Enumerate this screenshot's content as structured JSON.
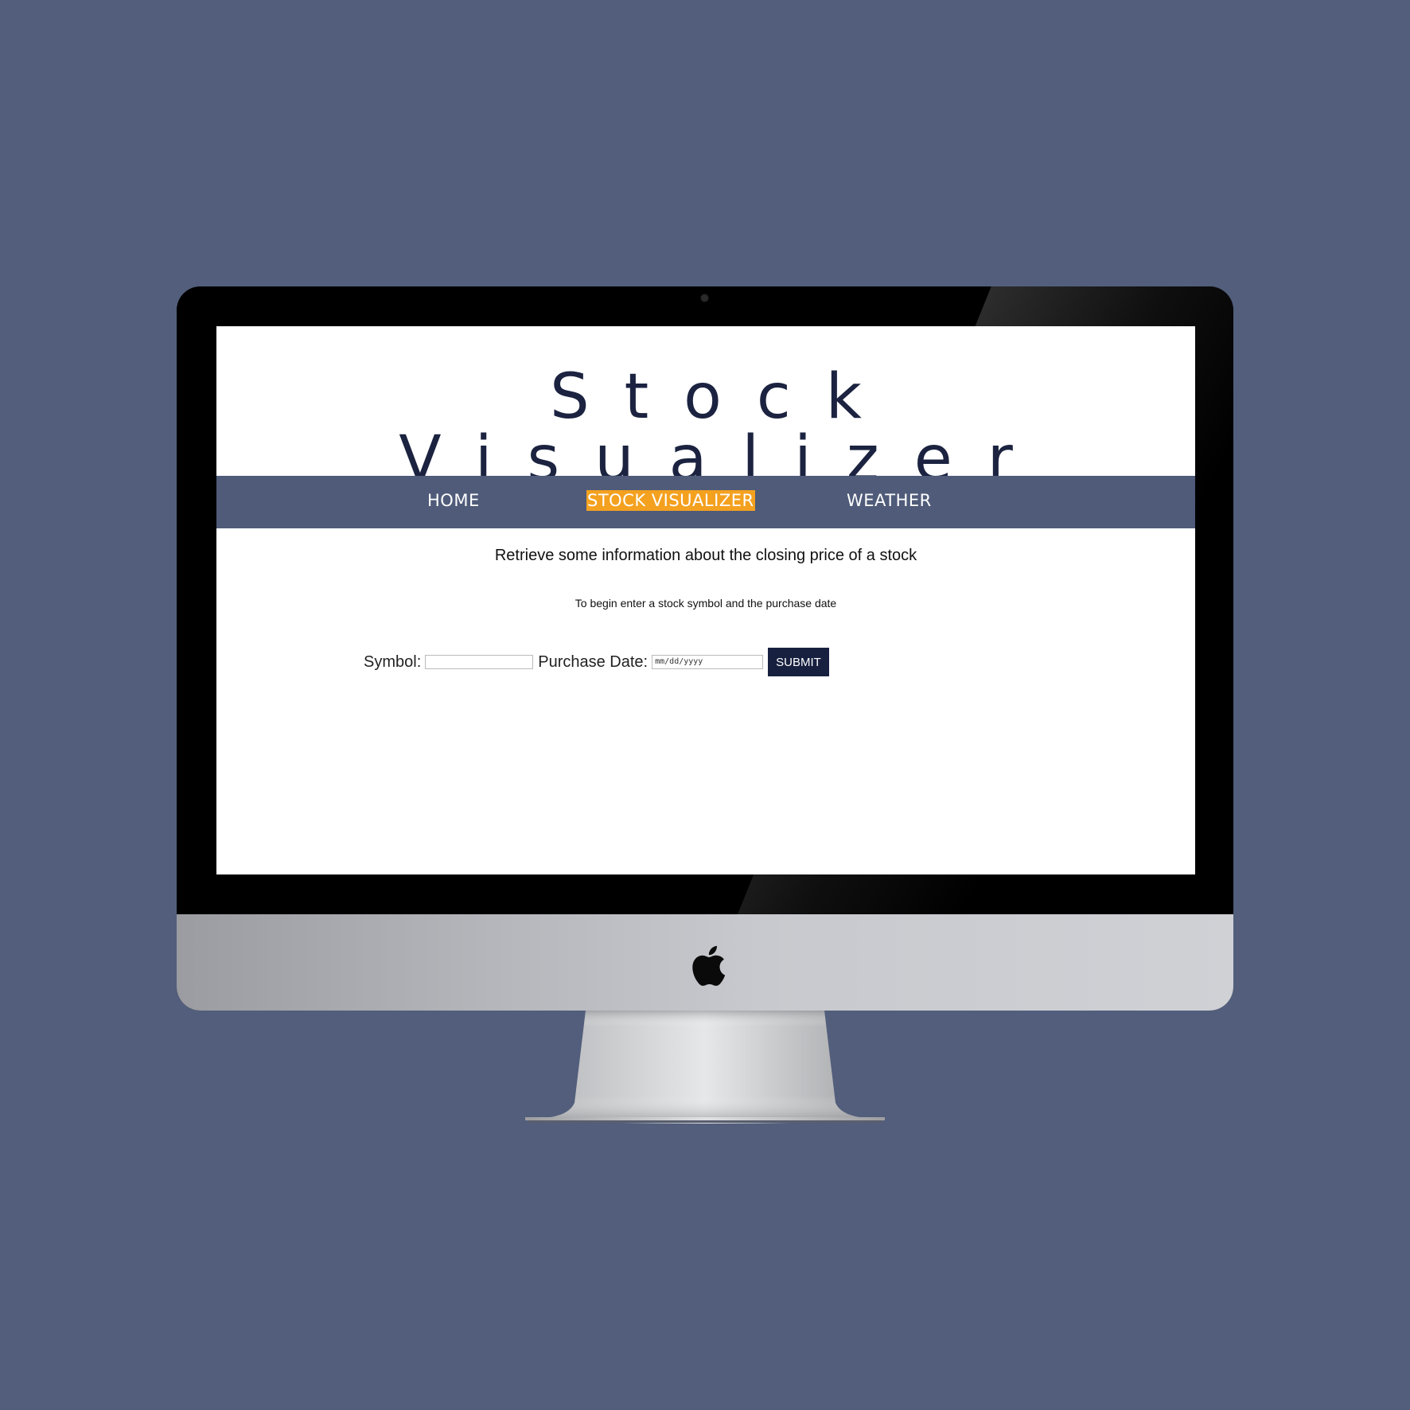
{
  "site": {
    "title": "Stock Visualizer"
  },
  "nav": {
    "items": [
      {
        "label": "HOME",
        "active": false
      },
      {
        "label": "STOCK VISUALIZER",
        "active": true
      },
      {
        "label": "WEATHER",
        "active": false
      }
    ]
  },
  "main": {
    "headline": "Retrieve some information about the closing price of a stock",
    "subline": "To begin enter a stock symbol and the purchase date"
  },
  "form": {
    "symbol_label": "Symbol:",
    "symbol_value": "",
    "date_label": "Purchase Date:",
    "date_placeholder": "mm/dd/yyyy",
    "submit_label": "SUBMIT"
  },
  "colors": {
    "background": "#525e7b",
    "navbar": "#4f5b79",
    "active_highlight": "#f4a120",
    "title_text": "#1b2340",
    "button": "#17203f"
  },
  "icons": {
    "brand_logo": "apple-logo-icon",
    "camera": "camera-dot"
  }
}
